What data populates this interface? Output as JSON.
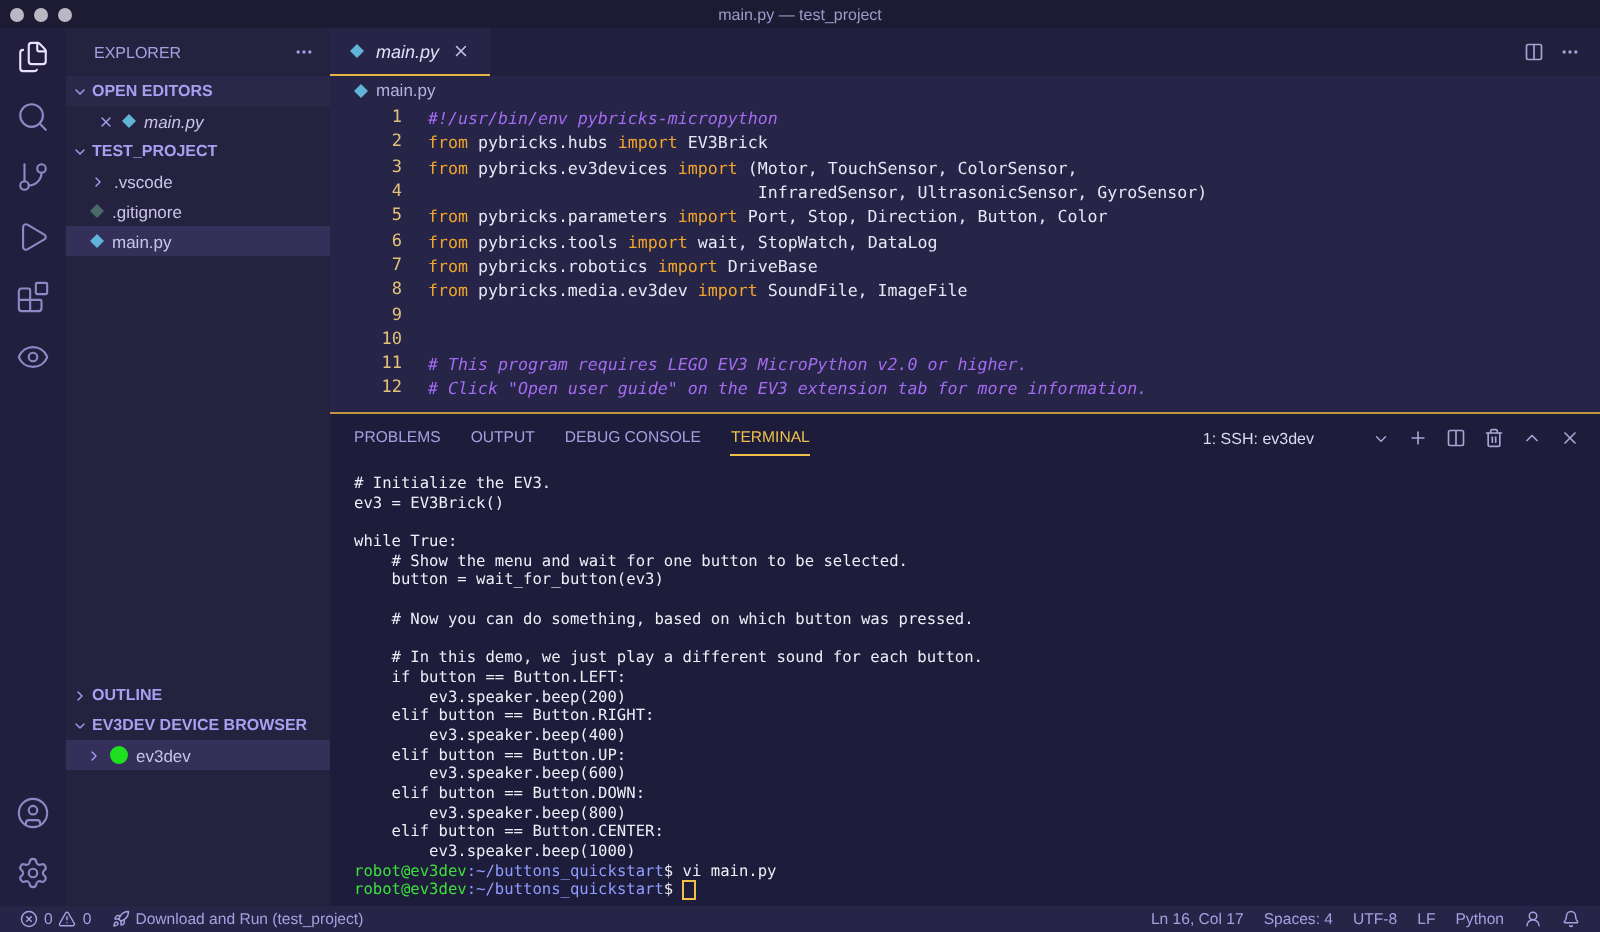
{
  "window": {
    "title": "main.py — test_project"
  },
  "sidebar": {
    "title": "EXPLORER",
    "sections": [
      {
        "label": "OPEN EDITORS",
        "expanded": true,
        "items": [
          {
            "label": "main.py",
            "kind": "open-file",
            "selected": false
          }
        ]
      },
      {
        "label": "TEST_PROJECT",
        "expanded": true,
        "items": [
          {
            "label": ".vscode",
            "kind": "folder",
            "selected": false
          },
          {
            "label": ".gitignore",
            "kind": "file",
            "selected": false
          },
          {
            "label": "main.py",
            "kind": "python",
            "selected": true
          }
        ]
      }
    ],
    "lower_sections": [
      {
        "label": "OUTLINE",
        "expanded": false
      },
      {
        "label": "EV3DEV DEVICE BROWSER",
        "expanded": true,
        "items": [
          {
            "label": "ev3dev",
            "kind": "device",
            "selected": true,
            "color": "#1ee01e"
          }
        ]
      }
    ]
  },
  "editor": {
    "tabs": [
      {
        "label": "main.py",
        "selected": true
      }
    ],
    "breadcrumb": "main.py",
    "lines": [
      {
        "number": "1",
        "tokens": [
          {
            "kind": "comment",
            "text": "#!/usr/bin/env pybricks-micropython"
          }
        ]
      },
      {
        "number": "2",
        "tokens": [
          {
            "kind": "keyword",
            "text": "from"
          },
          {
            "kind": "plain",
            "text": " pybricks.hubs "
          },
          {
            "kind": "keyword",
            "text": "import"
          },
          {
            "kind": "plain",
            "text": " EV3Brick"
          }
        ]
      },
      {
        "number": "3",
        "tokens": [
          {
            "kind": "keyword",
            "text": "from"
          },
          {
            "kind": "plain",
            "text": " pybricks.ev3devices "
          },
          {
            "kind": "keyword",
            "text": "import"
          },
          {
            "kind": "plain",
            "text": " (Motor, TouchSensor, ColorSensor,"
          }
        ]
      },
      {
        "number": "4",
        "tokens": [
          {
            "kind": "plain",
            "text": "                                 InfraredSensor, UltrasonicSensor, GyroSensor)"
          }
        ]
      },
      {
        "number": "5",
        "tokens": [
          {
            "kind": "keyword",
            "text": "from"
          },
          {
            "kind": "plain",
            "text": " pybricks.parameters "
          },
          {
            "kind": "keyword",
            "text": "import"
          },
          {
            "kind": "plain",
            "text": " Port, Stop, Direction, Button, Color"
          }
        ]
      },
      {
        "number": "6",
        "tokens": [
          {
            "kind": "keyword",
            "text": "from"
          },
          {
            "kind": "plain",
            "text": " pybricks.tools "
          },
          {
            "kind": "keyword",
            "text": "import"
          },
          {
            "kind": "plain",
            "text": " wait, StopWatch, DataLog"
          }
        ]
      },
      {
        "number": "7",
        "tokens": [
          {
            "kind": "keyword",
            "text": "from"
          },
          {
            "kind": "plain",
            "text": " pybricks.robotics "
          },
          {
            "kind": "keyword",
            "text": "import"
          },
          {
            "kind": "plain",
            "text": " DriveBase"
          }
        ]
      },
      {
        "number": "8",
        "tokens": [
          {
            "kind": "keyword",
            "text": "from"
          },
          {
            "kind": "plain",
            "text": " pybricks.media.ev3dev "
          },
          {
            "kind": "keyword",
            "text": "import"
          },
          {
            "kind": "plain",
            "text": " SoundFile, ImageFile"
          }
        ]
      },
      {
        "number": "9"
      },
      {
        "number": "10"
      },
      {
        "number": "11",
        "tokens": [
          {
            "kind": "comment",
            "text": "# This program requires LEGO EV3 MicroPython v2.0 or higher."
          }
        ]
      },
      {
        "number": "12",
        "tokens": [
          {
            "kind": "comment",
            "text": "# Click \"Open user guide\" on the EV3 extension tab for more information."
          }
        ]
      }
    ]
  },
  "panel": {
    "tabs": [
      {
        "label": "PROBLEMS",
        "selected": false
      },
      {
        "label": "OUTPUT",
        "selected": false
      },
      {
        "label": "DEBUG CONSOLE",
        "selected": false
      },
      {
        "label": "TERMINAL",
        "selected": true
      }
    ],
    "terminal_select": "1: SSH: ev3dev",
    "terminal": [
      {
        "kind": "output",
        "text": "# Initialize the EV3."
      },
      {
        "kind": "output",
        "text": "ev3 = EV3Brick()"
      },
      {
        "kind": "blank"
      },
      {
        "kind": "output",
        "text": "while True:"
      },
      {
        "kind": "output",
        "text": "    # Show the menu and wait for one button to be selected."
      },
      {
        "kind": "output",
        "text": "    button = wait_for_button(ev3)"
      },
      {
        "kind": "blank"
      },
      {
        "kind": "output",
        "text": "    # Now you can do something, based on which button was pressed."
      },
      {
        "kind": "blank"
      },
      {
        "kind": "output",
        "text": "    # In this demo, we just play a different sound for each button."
      },
      {
        "kind": "output",
        "text": "    if button == Button.LEFT:"
      },
      {
        "kind": "output",
        "text": "        ev3.speaker.beep(200)"
      },
      {
        "kind": "output",
        "text": "    elif button == Button.RIGHT:"
      },
      {
        "kind": "output",
        "text": "        ev3.speaker.beep(400)"
      },
      {
        "kind": "output",
        "text": "    elif button == Button.UP:"
      },
      {
        "kind": "output",
        "text": "        ev3.speaker.beep(600)"
      },
      {
        "kind": "output",
        "text": "    elif button == Button.DOWN:"
      },
      {
        "kind": "output",
        "text": "        ev3.speaker.beep(800)"
      },
      {
        "kind": "output",
        "text": "    elif button == Button.CENTER:"
      },
      {
        "kind": "output",
        "text": "        ev3.speaker.beep(1000)"
      },
      {
        "kind": "prompt",
        "user": "robot@ev3dev",
        "path": ":~/buttons_quickstart",
        "command": "$ vi main.py",
        "cursor": false
      },
      {
        "kind": "prompt",
        "user": "robot@ev3dev",
        "path": ":~/buttons_quickstart",
        "command": "$ ",
        "cursor": true
      }
    ]
  },
  "status_bar": {
    "errors": "0",
    "warnings": "0",
    "task": "Download and Run (test_project)",
    "items": [
      "Ln 16, Col 17",
      "Spaces: 4",
      "UTF-8",
      "LF",
      "Python"
    ]
  }
}
